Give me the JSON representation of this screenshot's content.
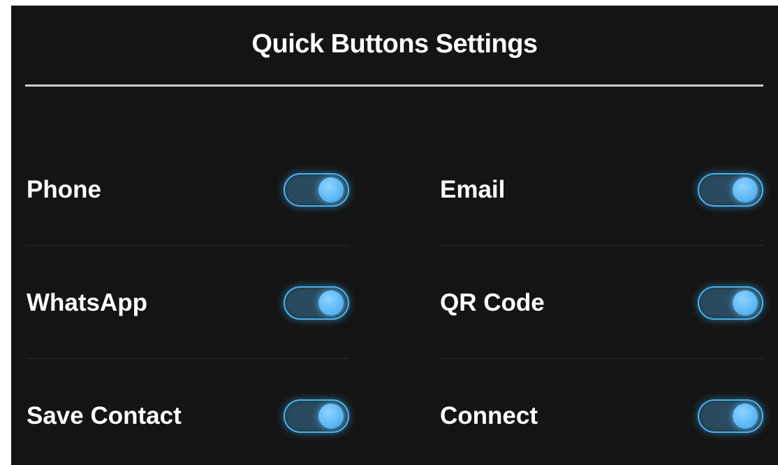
{
  "panel": {
    "title": "Quick Buttons Settings"
  },
  "settings": [
    {
      "label": "Phone",
      "enabled": true
    },
    {
      "label": "Email",
      "enabled": true
    },
    {
      "label": "WhatsApp",
      "enabled": true
    },
    {
      "label": "QR Code",
      "enabled": true
    },
    {
      "label": "Save Contact",
      "enabled": true
    },
    {
      "label": "Connect",
      "enabled": true
    }
  ],
  "colors": {
    "background": "#141414",
    "accent": "#46b2f0",
    "toggle_track": "#2a4b5f",
    "knob": "#5cb8f5"
  }
}
